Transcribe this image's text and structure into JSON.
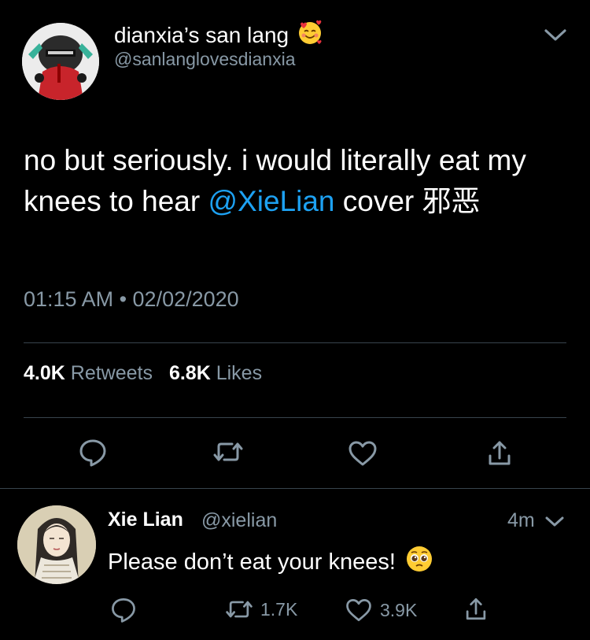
{
  "tweet": {
    "author_name": "dianxia’s san lang",
    "author_emoji_name": "smiling-face-with-hearts-emoji",
    "author_handle": "@sanlanglovesdianxia",
    "body_pre": "no but seriously. i would literally eat my knees to hear ",
    "mention": "@XieLian",
    "body_post": " cover 邪恶",
    "timestamp": "01:15 AM • 02/02/2020",
    "retweets_count": "4.0K",
    "retweets_label": "Retweets",
    "likes_count": "6.8K",
    "likes_label": "Likes"
  },
  "actions": {
    "reply_icon": "reply-icon",
    "retweet_icon": "retweet-icon",
    "like_icon": "heart-icon",
    "share_icon": "share-icon"
  },
  "reply": {
    "author_name": "Xie Lian",
    "author_handle": "@xielian",
    "time": "4m",
    "text": "Please don’t eat your knees!",
    "emoji_name": "pleading-face-emoji",
    "retweet_count": "1.7K",
    "like_count": "3.9K"
  },
  "colors": {
    "background": "#000000",
    "text": "#ffffff",
    "secondary": "#8899a6",
    "link": "#1da1f2",
    "divider": "#38444d"
  }
}
